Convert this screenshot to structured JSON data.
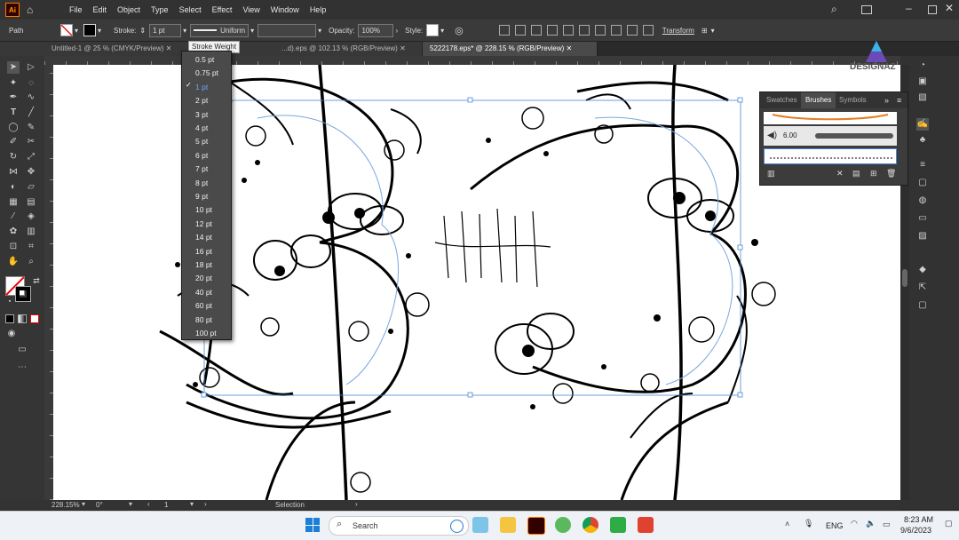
{
  "app": {
    "logo": "Ai"
  },
  "menu": [
    "File",
    "Edit",
    "Object",
    "Type",
    "Select",
    "Effect",
    "View",
    "Window",
    "Help"
  ],
  "control": {
    "object_type": "Path",
    "stroke_label": "Stroke:",
    "stroke_value": "1 pt",
    "profile": "Uniform",
    "opacity_label": "Opacity:",
    "opacity_value": "100%",
    "style_label": "Style:",
    "transform_label": "Transform",
    "tooltip": "Stroke Weight"
  },
  "tabs": [
    {
      "label": "Untitled-1 @ 25 % (CMYK/Preview)",
      "active": false
    },
    {
      "label": "...d).eps @ 102.13 % (RGB/Preview)",
      "active": false
    },
    {
      "label": "5222178.eps* @ 228.15 % (RGB/Preview)",
      "active": true
    }
  ],
  "stroke_weights": {
    "options": [
      "0.5 pt",
      "0.75 pt",
      "1 pt",
      "2 pt",
      "3 pt",
      "4 pt",
      "5 pt",
      "6 pt",
      "7 pt",
      "8 pt",
      "9 pt",
      "10 pt",
      "12 pt",
      "14 pt",
      "16 pt",
      "18 pt",
      "20 pt",
      "40 pt",
      "60 pt",
      "80 pt",
      "100 pt"
    ],
    "selected": "1 pt",
    "check": "✓"
  },
  "panel": {
    "tabs": [
      "Swatches",
      "Brushes",
      "Symbols"
    ],
    "active": "Brushes",
    "brush_size": "6.00"
  },
  "status": {
    "zoom": "228.15%",
    "rotation": "0°",
    "artboard": "1",
    "mode": "Selection"
  },
  "taskbar": {
    "search_placeholder": "Search",
    "lang": "ENG",
    "time": "8:23 AM",
    "date": "9/6/2023"
  },
  "watermark": "DESIGNAZ"
}
